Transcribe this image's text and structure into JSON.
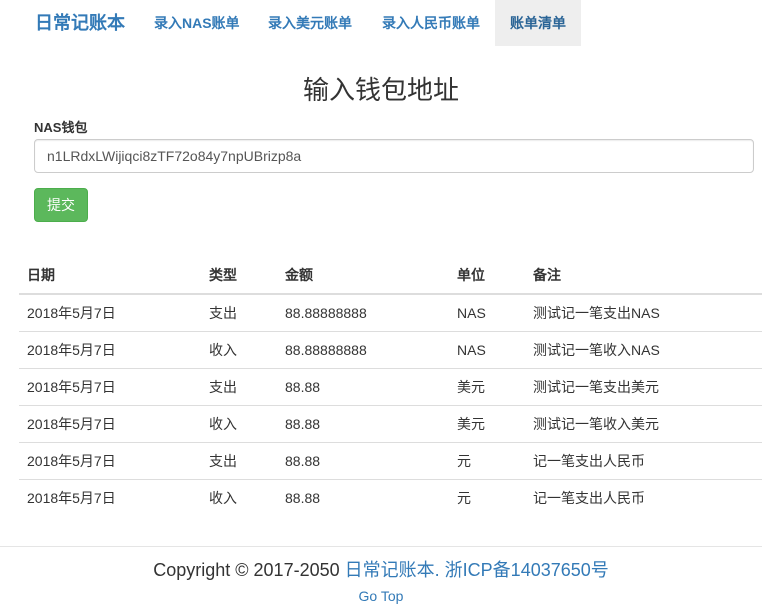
{
  "navbar": {
    "brand": "日常记账本",
    "items": [
      {
        "label": "录入NAS账单"
      },
      {
        "label": "录入美元账单"
      },
      {
        "label": "录入人民币账单"
      },
      {
        "label": "账单清单"
      }
    ]
  },
  "form": {
    "title": "输入钱包地址",
    "wallet_label": "NAS钱包",
    "wallet_value": "n1LRdxLWijiqci8zTF72o84y7npUBrizp8a",
    "submit_label": "提交"
  },
  "table": {
    "headers": [
      "日期",
      "类型",
      "金额",
      "单位",
      "备注"
    ],
    "rows": [
      [
        "2018年5月7日",
        "支出",
        "88.88888888",
        "NAS",
        "测试记一笔支出NAS"
      ],
      [
        "2018年5月7日",
        "收入",
        "88.88888888",
        "NAS",
        "测试记一笔收入NAS"
      ],
      [
        "2018年5月7日",
        "支出",
        "88.88",
        "美元",
        "测试记一笔支出美元"
      ],
      [
        "2018年5月7日",
        "收入",
        "88.88",
        "美元",
        "测试记一笔收入美元"
      ],
      [
        "2018年5月7日",
        "支出",
        "88.88",
        "元",
        "记一笔支出人民币"
      ],
      [
        "2018年5月7日",
        "收入",
        "88.88",
        "元",
        "记一笔支出人民币"
      ]
    ]
  },
  "footer": {
    "copyright_text": "Copyright © 2017-2050",
    "site_link": "日常记账本.",
    "icp_link": "浙ICP备14037650号",
    "go_top": "Go Top"
  }
}
